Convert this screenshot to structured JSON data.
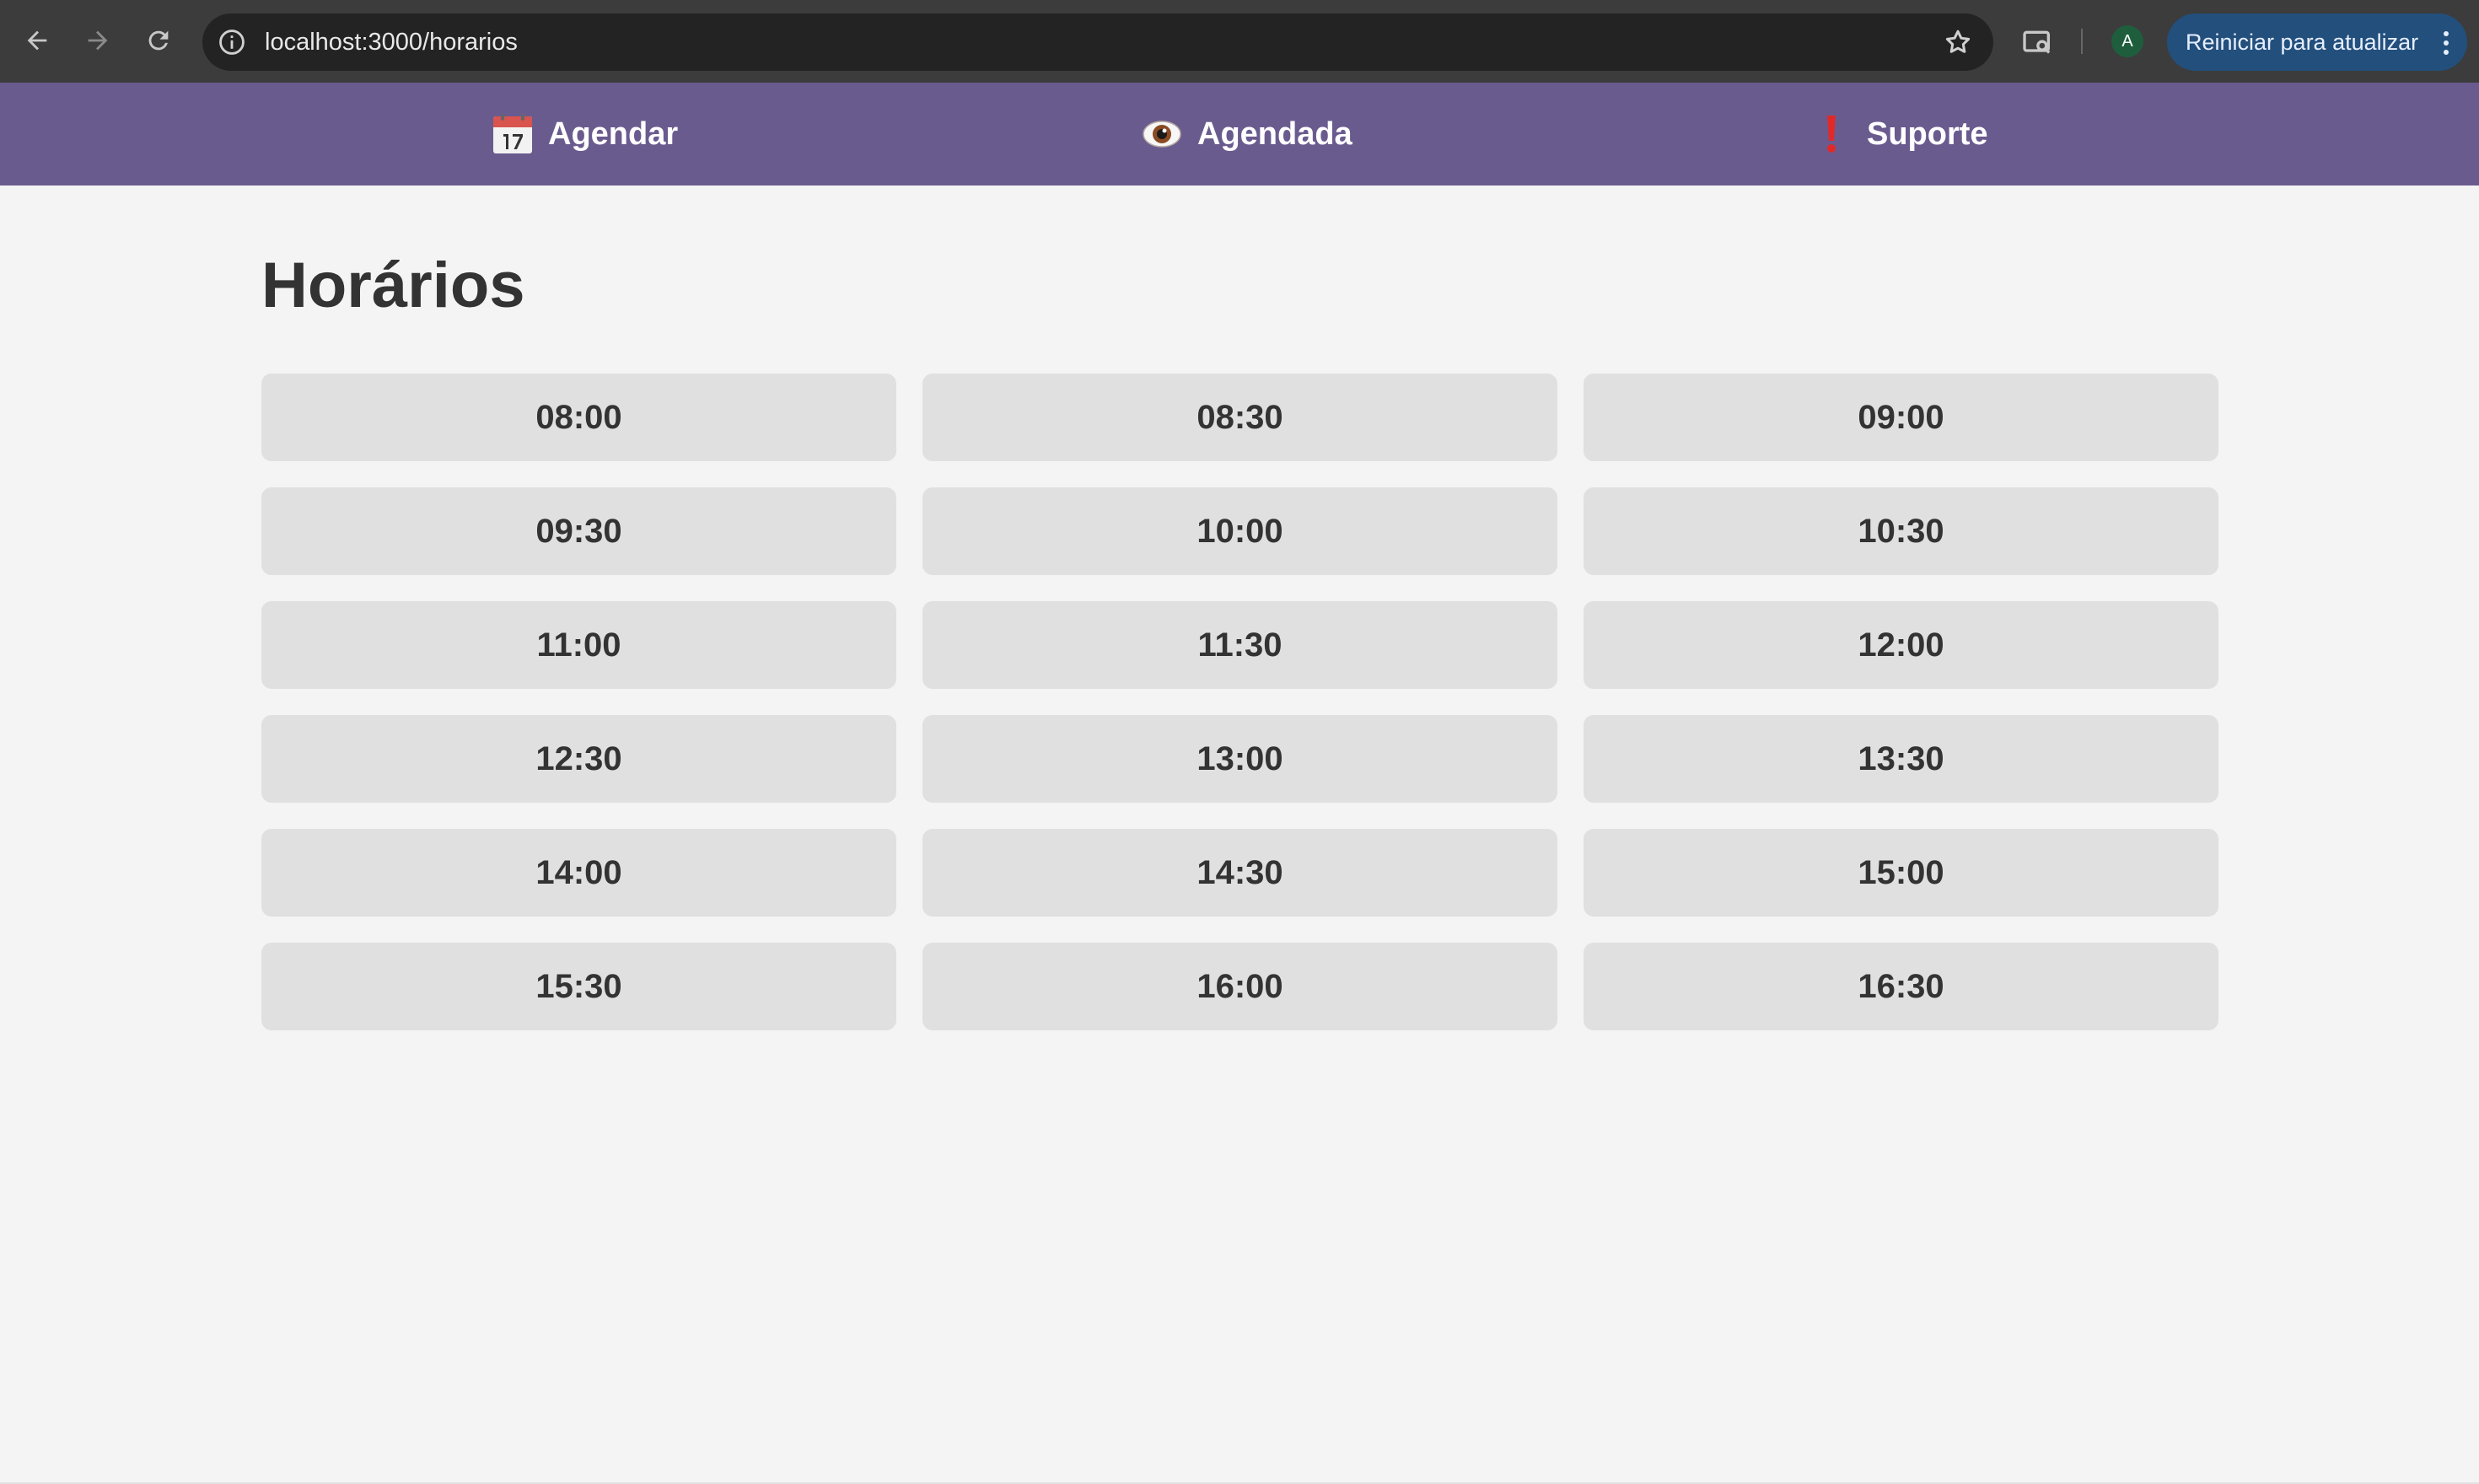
{
  "browser": {
    "url": "localhost:3000/horarios",
    "profile_initial": "A",
    "update_button_label": "Reiniciar para atualizar",
    "icons": [
      "back-icon",
      "forward-icon",
      "reload-icon",
      "site-info-icon",
      "bookmark-star-icon",
      "tab-search-icon",
      "menu-kebab-icon"
    ]
  },
  "nav": {
    "items": [
      {
        "label": "Agendar",
        "icon": "calendar-icon"
      },
      {
        "label": "Agendada",
        "icon": "eye-icon"
      },
      {
        "label": "Suporte",
        "icon": "exclamation-icon"
      }
    ],
    "background": "#6a5b8f"
  },
  "page": {
    "title": "Horários"
  },
  "slots": [
    "08:00",
    "08:30",
    "09:00",
    "09:30",
    "10:00",
    "10:30",
    "11:00",
    "11:30",
    "12:00",
    "12:30",
    "13:00",
    "13:30",
    "14:00",
    "14:30",
    "15:00",
    "15:30",
    "16:00",
    "16:30"
  ],
  "colors": {
    "slot_background": "#e0e0e0",
    "page_background": "#f4f4f4",
    "text": "#333333"
  }
}
